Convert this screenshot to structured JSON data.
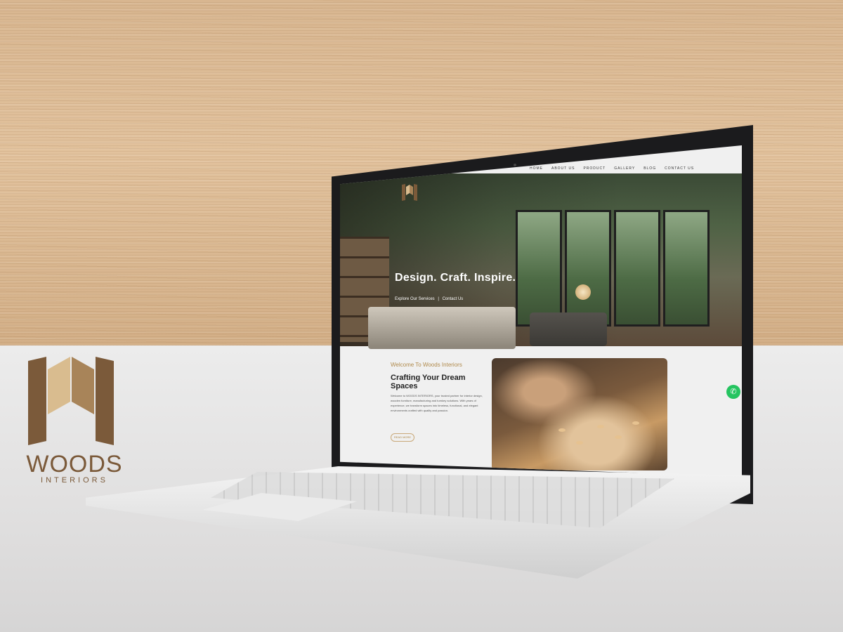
{
  "brand": {
    "name": "WOODS",
    "sub": "INTERIORS"
  },
  "site": {
    "nav": [
      "HOME",
      "ABOUT US",
      "PRODUCT",
      "GALLERY",
      "BLOG",
      "CONTACT US"
    ],
    "hero": {
      "title": "Design. Craft. Inspire.",
      "link1": "Explore Our Services",
      "sep": "|",
      "link2": "Contact Us"
    },
    "welcome": {
      "eyebrow": "Welcome To Woods Interiors",
      "title": "Crafting Your Dream Spaces",
      "body": "Welcome to WOODS INTERIORS, your trusted partner for interior design, wooden furniture, manufacturing and turnkey solutions. With years of experience, we transform spaces into timeless, functional, and elegant environments crafted with quality and passion.",
      "button": "READ MORE"
    },
    "whatsapp_icon": "whatsapp-icon"
  },
  "colors": {
    "accent": "#b08a4c",
    "wood": "#d8b690",
    "brand": "#7b5a3a",
    "whatsapp": "#25c460"
  }
}
